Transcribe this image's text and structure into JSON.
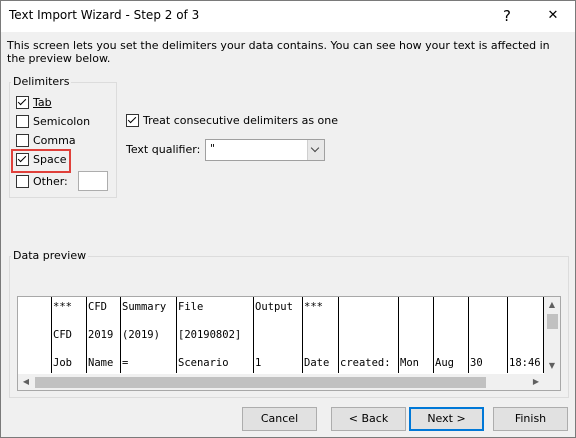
{
  "window": {
    "title": "Text Import Wizard - Step 2 of 3",
    "help_label": "?",
    "close_label": "✕"
  },
  "instructions": "This screen lets you set the delimiters your data contains.  You can see how your text is affected in the preview below.",
  "delimiters": {
    "label": "Delimiters",
    "tab": {
      "label": "Tab",
      "checked": true
    },
    "semicolon": {
      "label": "Semicolon",
      "checked": false
    },
    "comma": {
      "label": "Comma",
      "checked": false
    },
    "space": {
      "label": "Space",
      "checked": true
    },
    "other": {
      "label": "Other:",
      "checked": false,
      "value": ""
    }
  },
  "consecutive": {
    "label": "Treat consecutive delimiters as one",
    "checked": true
  },
  "qualifier": {
    "label": "Text qualifier:",
    "value": "\""
  },
  "preview": {
    "label": "Data preview",
    "rows": [
      [
        "***",
        "CFD",
        "Summary",
        "File",
        "Output",
        "***",
        "",
        "",
        "",
        "",
        ""
      ],
      [
        "CFD",
        "2019",
        "(2019)",
        "[20190802]",
        "",
        "",
        "",
        "",
        "",
        "",
        ""
      ],
      [
        "Job",
        "Name",
        "=",
        "Scenario",
        "1",
        "Date",
        "created:",
        "Mon",
        "Aug",
        "30",
        "18:46"
      ]
    ]
  },
  "buttons": {
    "cancel": "Cancel",
    "back": "< Back",
    "next": "Next >",
    "finish": "Finish"
  },
  "colors": {
    "focus_highlight": "#e0403a",
    "default_button_border": "#0078d7"
  }
}
